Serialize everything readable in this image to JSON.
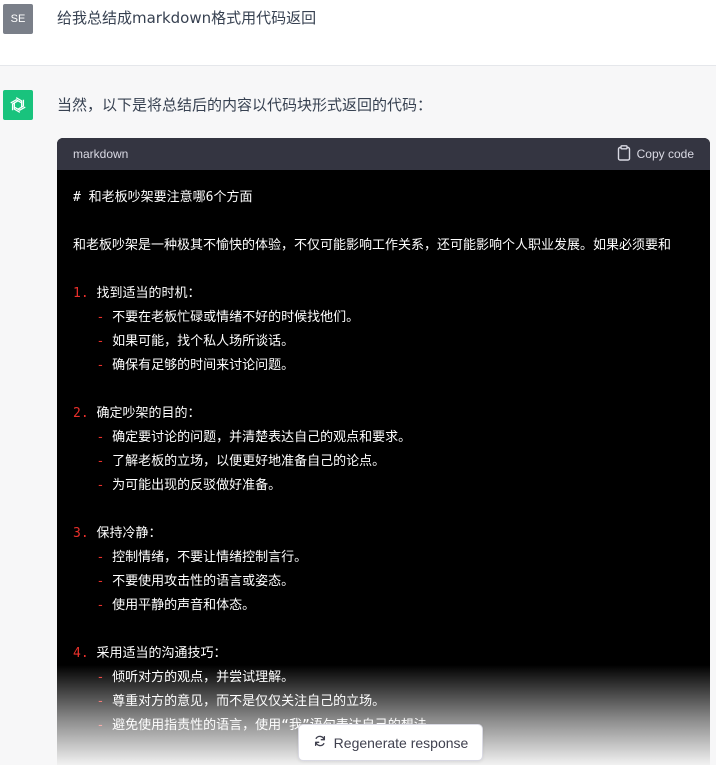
{
  "user": {
    "avatar_initials": "SE",
    "message": "给我总结成markdown格式用代码返回"
  },
  "assistant": {
    "avatar_icon": "openai-logo-icon",
    "avatar_color": "#19c37d",
    "intro": "当然，以下是将总结后的内容以代码块形式返回的代码：",
    "code_block": {
      "language": "markdown",
      "copy_label": "Copy code",
      "copy_icon": "clipboard-icon",
      "lines": [
        {
          "marker": "",
          "text": "# 和老板吵架要注意哪6个方面"
        },
        {
          "marker": "",
          "text": ""
        },
        {
          "marker": "",
          "text": "和老板吵架是一种极其不愉快的体验，不仅可能影响工作关系，还可能影响个人职业发展。如果必须要和"
        },
        {
          "marker": "",
          "text": ""
        },
        {
          "marker": "1.",
          "text": " 找到适当的时机："
        },
        {
          "marker": "   -",
          "text": " 不要在老板忙碌或情绪不好的时候找他们。"
        },
        {
          "marker": "   -",
          "text": " 如果可能，找个私人场所谈话。"
        },
        {
          "marker": "   -",
          "text": " 确保有足够的时间来讨论问题。"
        },
        {
          "marker": "",
          "text": ""
        },
        {
          "marker": "2.",
          "text": " 确定吵架的目的："
        },
        {
          "marker": "   -",
          "text": " 确定要讨论的问题，并清楚表达自己的观点和要求。"
        },
        {
          "marker": "   -",
          "text": " 了解老板的立场，以便更好地准备自己的论点。"
        },
        {
          "marker": "   -",
          "text": " 为可能出现的反驳做好准备。"
        },
        {
          "marker": "",
          "text": ""
        },
        {
          "marker": "3.",
          "text": " 保持冷静："
        },
        {
          "marker": "   -",
          "text": " 控制情绪，不要让情绪控制言行。"
        },
        {
          "marker": "   -",
          "text": " 不要使用攻击性的语言或姿态。"
        },
        {
          "marker": "   -",
          "text": " 使用平静的声音和体态。"
        },
        {
          "marker": "",
          "text": ""
        },
        {
          "marker": "4.",
          "text": " 采用适当的沟通技巧："
        },
        {
          "marker": "   -",
          "text": " 倾听对方的观点，并尝试理解。"
        },
        {
          "marker": "   -",
          "text": " 尊重对方的意见，而不是仅仅关注自己的立场。"
        },
        {
          "marker": "   -",
          "text": " 避免使用指责性的语言，使用“我”语句表达自己的想法。"
        }
      ]
    }
  },
  "regenerate": {
    "label": "Regenerate response",
    "icon": "refresh-icon"
  }
}
